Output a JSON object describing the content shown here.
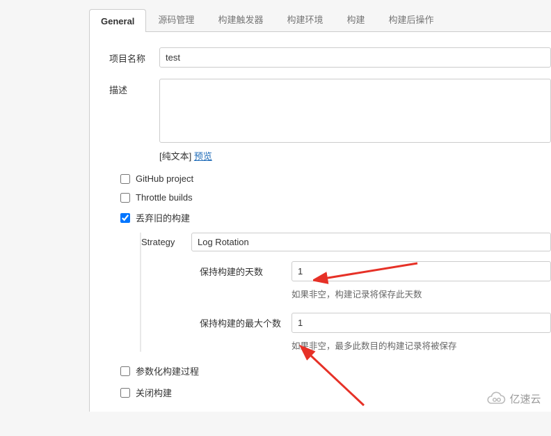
{
  "tabs": {
    "general": "General",
    "scm": "源码管理",
    "triggers": "构建触发器",
    "environment": "构建环境",
    "build": "构建",
    "post": "构建后操作"
  },
  "projectName": {
    "label": "项目名称",
    "value": "test"
  },
  "description": {
    "label": "描述",
    "value": "",
    "plainText": "[纯文本]",
    "previewLink": "预览"
  },
  "checkboxes": {
    "github": {
      "label": "GitHub project",
      "checked": false
    },
    "throttle": {
      "label": "Throttle builds",
      "checked": false
    },
    "discard": {
      "label": "丢弃旧的构建",
      "checked": true
    },
    "parameterized": {
      "label": "参数化构建过程",
      "checked": false
    },
    "disable": {
      "label": "关闭构建",
      "checked": false
    }
  },
  "strategy": {
    "label": "Strategy",
    "value": "Log Rotation"
  },
  "daysToKeep": {
    "label": "保持构建的天数",
    "value": "1",
    "hint": "如果非空，构建记录将保存此天数"
  },
  "maxToKeep": {
    "label": "保持构建的最大个数",
    "value": "1",
    "hint": "如果非空，最多此数目的构建记录将被保存"
  },
  "brand": "亿速云"
}
